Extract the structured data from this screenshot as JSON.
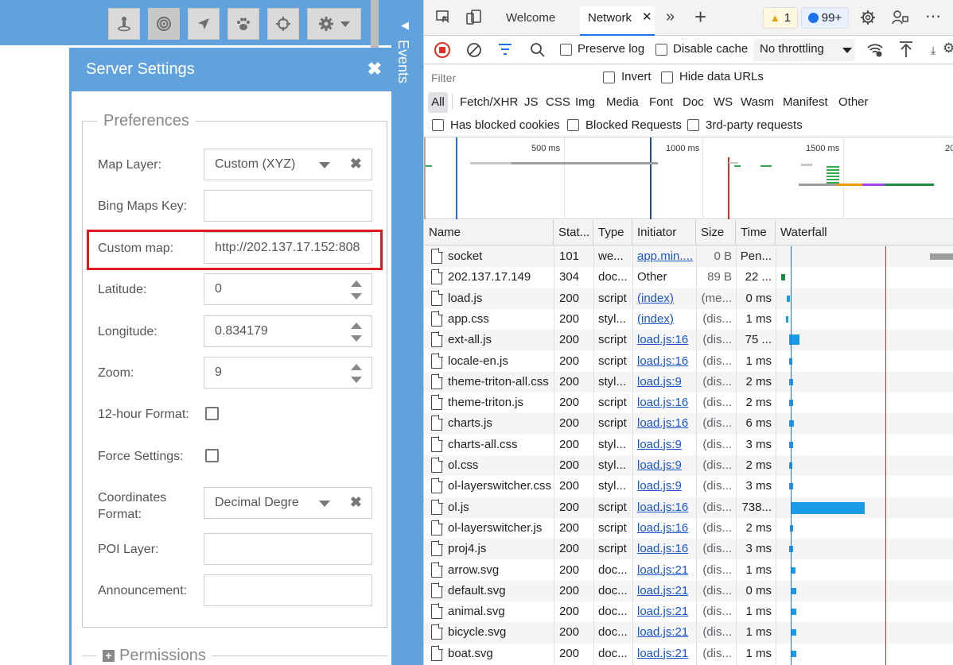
{
  "app": {
    "toolbar": [
      {
        "name": "geofence-button",
        "icon": "person-pin-icon"
      },
      {
        "name": "target-button",
        "icon": "radar-icon"
      },
      {
        "name": "navigate-button",
        "icon": "location-arrow-icon"
      },
      {
        "name": "paw-button",
        "icon": "paw-icon"
      },
      {
        "name": "crosshair-button",
        "icon": "crosshair-icon"
      },
      {
        "name": "settings-button",
        "icon": "gear-icon"
      }
    ],
    "events_label": "Events",
    "dialog": {
      "title": "Server Settings",
      "preferences_legend": "Preferences",
      "permissions_legend": "Permissions",
      "fields": {
        "map_layer": {
          "label": "Map Layer:",
          "value": "Custom (XYZ)"
        },
        "bing_key": {
          "label": "Bing Maps Key:",
          "value": ""
        },
        "custom_map": {
          "label": "Custom map:",
          "value": "http://202.137.17.152:808"
        },
        "latitude": {
          "label": "Latitude:",
          "value": "0"
        },
        "longitude": {
          "label": "Longitude:",
          "value": "0.834179"
        },
        "zoom": {
          "label": "Zoom:",
          "value": "9"
        },
        "twelve_hour": {
          "label": "12-hour Format:",
          "checked": false
        },
        "force_settings": {
          "label": "Force Settings:",
          "checked": false
        },
        "coords_format": {
          "label_line1": "Coordinates",
          "label_line2": "Format:",
          "value": "Decimal Degre"
        },
        "poi_layer": {
          "label": "POI Layer:",
          "value": ""
        },
        "announcement": {
          "label": "Announcement:",
          "value": ""
        }
      }
    }
  },
  "devtools": {
    "tabs": {
      "welcome": "Welcome",
      "network": "Network"
    },
    "badges": {
      "warnings": "1",
      "messages": "99+"
    },
    "toolbar": {
      "preserve_log": "Preserve log",
      "disable_cache": "Disable cache",
      "throttling": "No throttling"
    },
    "filter": {
      "placeholder": "Filter",
      "invert": "Invert",
      "hide_data_urls": "Hide data URLs",
      "all": "All",
      "types": [
        "Fetch/XHR",
        "JS",
        "CSS",
        "Img",
        "Media",
        "Font",
        "Doc",
        "WS",
        "Wasm",
        "Manifest",
        "Other"
      ],
      "has_blocked_cookies": "Has blocked cookies",
      "blocked_requests": "Blocked Requests",
      "third_party": "3rd-party requests"
    },
    "overview_ticks": [
      "500 ms",
      "1000 ms",
      "1500 ms",
      "20"
    ],
    "columns": [
      "Name",
      "Stat...",
      "Type",
      "Initiator",
      "Size",
      "Time",
      "Waterfall"
    ],
    "rows": [
      {
        "name": "socket",
        "status": "101",
        "type": "we...",
        "initiator": "app.min....",
        "init_link": true,
        "size": "0 B",
        "time": "Pen..."
      },
      {
        "name": "202.137.17.149",
        "status": "304",
        "type": "doc...",
        "initiator": "Other",
        "init_link": false,
        "size": "89 B",
        "time": "22 ..."
      },
      {
        "name": "load.js",
        "status": "200",
        "type": "script",
        "initiator": "(index)",
        "init_link": true,
        "size": "(me...",
        "time": "0 ms"
      },
      {
        "name": "app.css",
        "status": "200",
        "type": "styl...",
        "initiator": "(index)",
        "init_link": true,
        "size": "(dis...",
        "time": "1 ms"
      },
      {
        "name": "ext-all.js",
        "status": "200",
        "type": "script",
        "initiator": "load.js:16",
        "init_link": true,
        "size": "(dis...",
        "time": "75 ..."
      },
      {
        "name": "locale-en.js",
        "status": "200",
        "type": "script",
        "initiator": "load.js:16",
        "init_link": true,
        "size": "(dis...",
        "time": "1 ms"
      },
      {
        "name": "theme-triton-all.css",
        "status": "200",
        "type": "styl...",
        "initiator": "load.js:9",
        "init_link": true,
        "size": "(dis...",
        "time": "2 ms"
      },
      {
        "name": "theme-triton.js",
        "status": "200",
        "type": "script",
        "initiator": "load.js:16",
        "init_link": true,
        "size": "(dis...",
        "time": "2 ms"
      },
      {
        "name": "charts.js",
        "status": "200",
        "type": "script",
        "initiator": "load.js:16",
        "init_link": true,
        "size": "(dis...",
        "time": "6 ms"
      },
      {
        "name": "charts-all.css",
        "status": "200",
        "type": "styl...",
        "initiator": "load.js:9",
        "init_link": true,
        "size": "(dis...",
        "time": "3 ms"
      },
      {
        "name": "ol.css",
        "status": "200",
        "type": "styl...",
        "initiator": "load.js:9",
        "init_link": true,
        "size": "(dis...",
        "time": "2 ms"
      },
      {
        "name": "ol-layerswitcher.css",
        "status": "200",
        "type": "styl...",
        "initiator": "load.js:9",
        "init_link": true,
        "size": "(dis...",
        "time": "3 ms"
      },
      {
        "name": "ol.js",
        "status": "200",
        "type": "script",
        "initiator": "load.js:16",
        "init_link": true,
        "size": "(dis...",
        "time": "738..."
      },
      {
        "name": "ol-layerswitcher.js",
        "status": "200",
        "type": "script",
        "initiator": "load.js:16",
        "init_link": true,
        "size": "(dis...",
        "time": "2 ms"
      },
      {
        "name": "proj4.js",
        "status": "200",
        "type": "script",
        "initiator": "load.js:16",
        "init_link": true,
        "size": "(dis...",
        "time": "3 ms"
      },
      {
        "name": "arrow.svg",
        "status": "200",
        "type": "doc...",
        "initiator": "load.js:21",
        "init_link": true,
        "size": "(dis...",
        "time": "1 ms"
      },
      {
        "name": "default.svg",
        "status": "200",
        "type": "doc...",
        "initiator": "load.js:21",
        "init_link": true,
        "size": "(dis...",
        "time": "0 ms"
      },
      {
        "name": "animal.svg",
        "status": "200",
        "type": "doc...",
        "initiator": "load.js:21",
        "init_link": true,
        "size": "(dis...",
        "time": "1 ms"
      },
      {
        "name": "bicycle.svg",
        "status": "200",
        "type": "doc...",
        "initiator": "load.js:21",
        "init_link": true,
        "size": "(dis...",
        "time": "1 ms"
      },
      {
        "name": "boat.svg",
        "status": "200",
        "type": "doc...",
        "initiator": "load.js:21",
        "init_link": true,
        "size": "(dis...",
        "time": "1 ms"
      }
    ],
    "colors": {
      "accent": "#1a73e8",
      "app_blue": "#5fa2dd",
      "highlight_red": "#e0191f",
      "waterfall_bar": "#1a9be6",
      "load_line": "#d93025"
    }
  }
}
